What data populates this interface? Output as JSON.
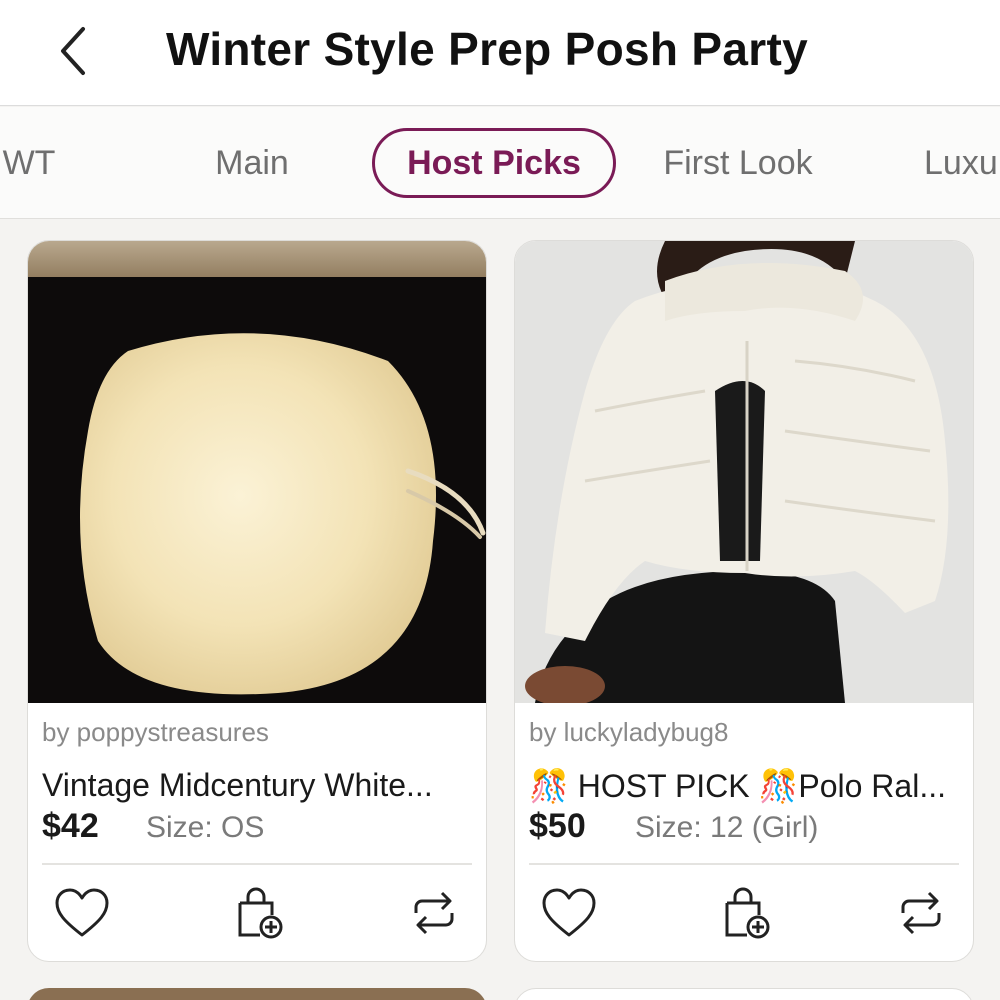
{
  "header": {
    "title": "Winter Style Prep Posh Party",
    "back_icon": "chevron-left-icon"
  },
  "tabs": [
    {
      "label": "WT"
    },
    {
      "label": "Main"
    },
    {
      "label": "Host Picks",
      "active": true
    },
    {
      "label": "First Look"
    },
    {
      "label": "Luxu"
    }
  ],
  "listings": [
    {
      "seller": "by poppystreasures",
      "title": "Vintage Midcentury White...",
      "price": "$42",
      "size": "Size: OS",
      "image": "white fur muff on black background"
    },
    {
      "seller": "by luckyladybug8",
      "title_prefix": "🎊",
      "title": "HOST PICK 🎊Polo Ral...",
      "price": "$50",
      "size": "Size: 12 (Girl)",
      "image": "woman wearing cream cropped puffer jacket"
    }
  ],
  "actions": {
    "like_icon": "heart-icon",
    "bundle_icon": "bag-plus-icon",
    "share_icon": "share-repost-icon"
  },
  "colors": {
    "accent": "#7a1b56",
    "background": "#f4f3f1",
    "card": "#ffffff"
  }
}
